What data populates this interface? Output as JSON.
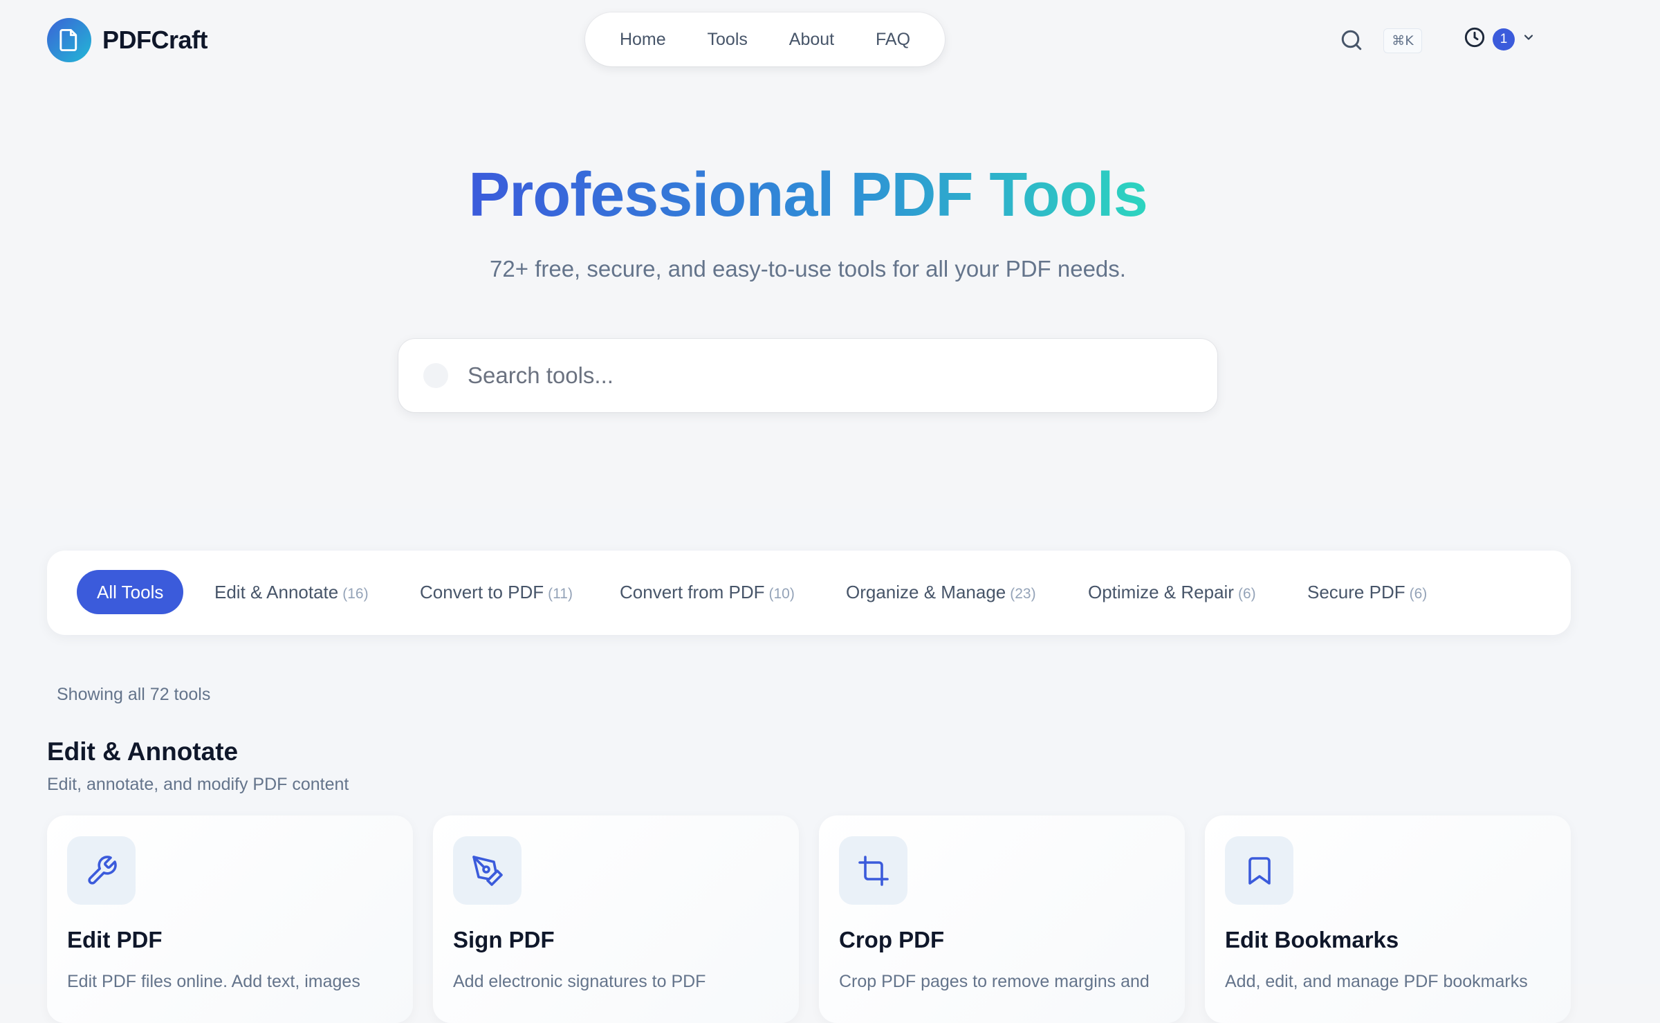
{
  "header": {
    "brand": "PDFCraft",
    "nav": [
      {
        "label": "Home"
      },
      {
        "label": "Tools"
      },
      {
        "label": "About"
      },
      {
        "label": "FAQ"
      }
    ],
    "shortcut": "⌘K",
    "history_count": "1",
    "icons": {
      "logo": "document-icon",
      "search": "search-icon",
      "history": "clock-icon",
      "dropdown": "chevron-down-icon"
    }
  },
  "hero": {
    "title": "Professional PDF Tools",
    "subtitle": "72+ free, secure, and easy-to-use tools for all your PDF needs.",
    "search_placeholder": "Search tools..."
  },
  "filters": [
    {
      "label": "All Tools",
      "count": "",
      "active": true
    },
    {
      "label": "Edit & Annotate",
      "count": "(16)"
    },
    {
      "label": "Convert to PDF",
      "count": "(11)"
    },
    {
      "label": "Convert from PDF",
      "count": "(10)"
    },
    {
      "label": "Organize & Manage",
      "count": "(23)"
    },
    {
      "label": "Optimize & Repair",
      "count": "(6)"
    },
    {
      "label": "Secure PDF",
      "count": "(6)"
    }
  ],
  "results": {
    "showing": "Showing all 72 tools"
  },
  "section": {
    "title": "Edit & Annotate",
    "subtitle": "Edit, annotate, and modify PDF content"
  },
  "cards": [
    {
      "title": "Edit PDF",
      "desc": "Edit PDF files online. Add text, images",
      "icon": "wrench-icon"
    },
    {
      "title": "Sign PDF",
      "desc": "Add electronic signatures to PDF",
      "icon": "pen-tool-icon"
    },
    {
      "title": "Crop PDF",
      "desc": "Crop PDF pages to remove margins and",
      "icon": "crop-icon"
    },
    {
      "title": "Edit Bookmarks",
      "desc": "Add, edit, and manage PDF bookmarks",
      "icon": "bookmark-icon"
    }
  ],
  "colors": {
    "accent": "#3b5bdb",
    "gradient_start": "#3b5bdb",
    "gradient_end": "#2dd4bf",
    "background": "#f5f6f8"
  }
}
